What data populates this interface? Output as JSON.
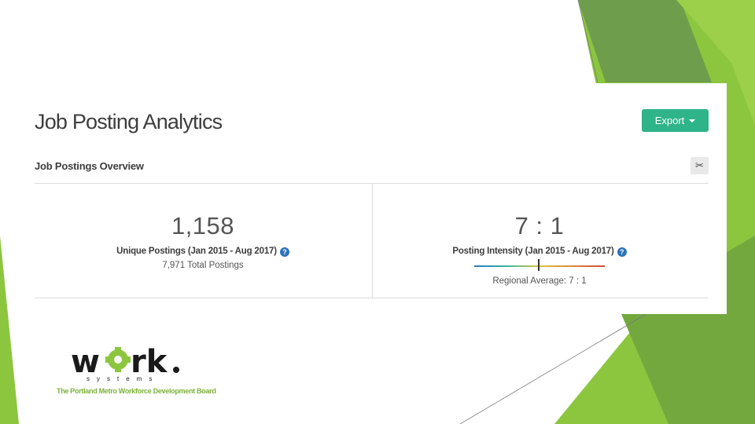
{
  "page": {
    "title": "Job Posting Analytics",
    "export_label": "Export",
    "section_title": "Job Postings Overview"
  },
  "metrics": {
    "unique": {
      "value": "1,158",
      "label": "Unique Postings (Jan 2015 - Aug 2017)",
      "sub": "7,971 Total Postings"
    },
    "intensity": {
      "value": "7 : 1",
      "label": "Posting Intensity (Jan 2015 - Aug 2017)",
      "sub": "Regional Average: 7 : 1"
    }
  },
  "logo": {
    "word": "w  rk.",
    "sub": "systems",
    "tagline": "The Portland Metro Workforce Development Board"
  },
  "colors": {
    "accent": "#2fb48a",
    "help": "#2e73b8",
    "deco_green": "#8cc63f"
  },
  "icons": [
    "chevron-down-icon",
    "scissors-icon",
    "help-icon"
  ]
}
